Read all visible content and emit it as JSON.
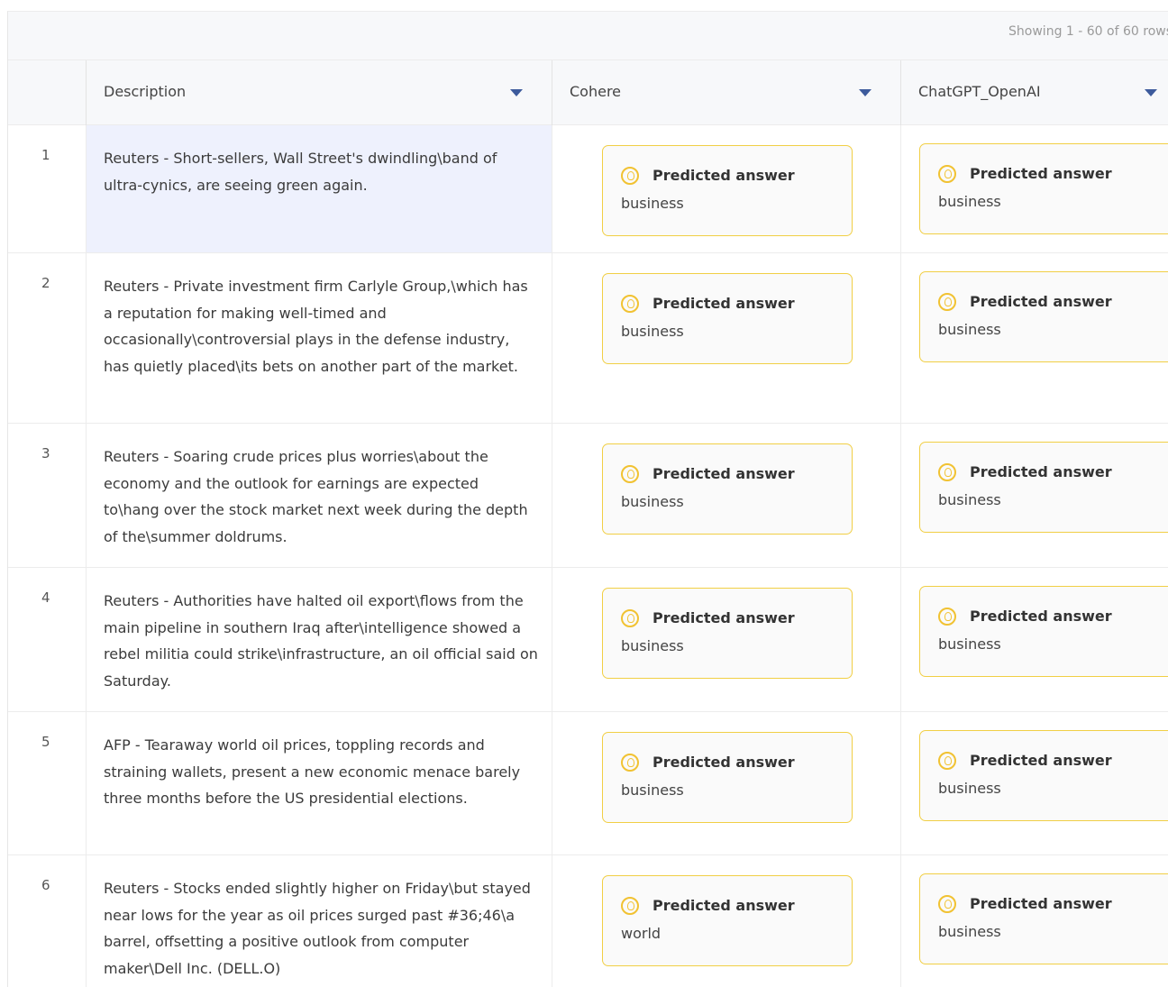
{
  "table": {
    "row_count_text": "Showing 1 - 60 of 60 rows",
    "columns": [
      {
        "label": "Description"
      },
      {
        "label": "Cohere"
      },
      {
        "label": "ChatGPT_OpenAI"
      }
    ],
    "card_title": "Predicted answer",
    "rows": [
      {
        "index": "1",
        "description": "Reuters - Short-sellers, Wall Street's dwindling\\band of ultra-cynics, are seeing green again.",
        "cohere": "business",
        "chatgpt": "business"
      },
      {
        "index": "2",
        "description": "Reuters - Private investment firm Carlyle Group,\\which has a reputation for making well-timed and occasionally\\controversial plays in the defense industry, has quietly placed\\its bets on another part of the market.",
        "cohere": "business",
        "chatgpt": "business"
      },
      {
        "index": "3",
        "description": "Reuters - Soaring crude prices plus worries\\about the economy and the outlook for earnings are expected to\\hang over the stock market next week during the depth of the\\summer doldrums.",
        "cohere": "business",
        "chatgpt": "business"
      },
      {
        "index": "4",
        "description": "Reuters - Authorities have halted oil export\\flows from the main pipeline in southern Iraq after\\intelligence showed a rebel militia could strike\\infrastructure, an oil official said on Saturday.",
        "cohere": "business",
        "chatgpt": "business"
      },
      {
        "index": "5",
        "description": "AFP - Tearaway world oil prices, toppling records and straining wallets, present a new economic menace barely three months before the US presidential elections.",
        "cohere": "business",
        "chatgpt": "business"
      },
      {
        "index": "6",
        "description": "Reuters - Stocks ended slightly higher on Friday\\but stayed near lows for the year as oil prices surged past  #36;46\\a barrel, offsetting a positive outlook from computer maker\\Dell Inc. (DELL.O)",
        "cohere": "world",
        "chatgpt": "business"
      }
    ]
  }
}
